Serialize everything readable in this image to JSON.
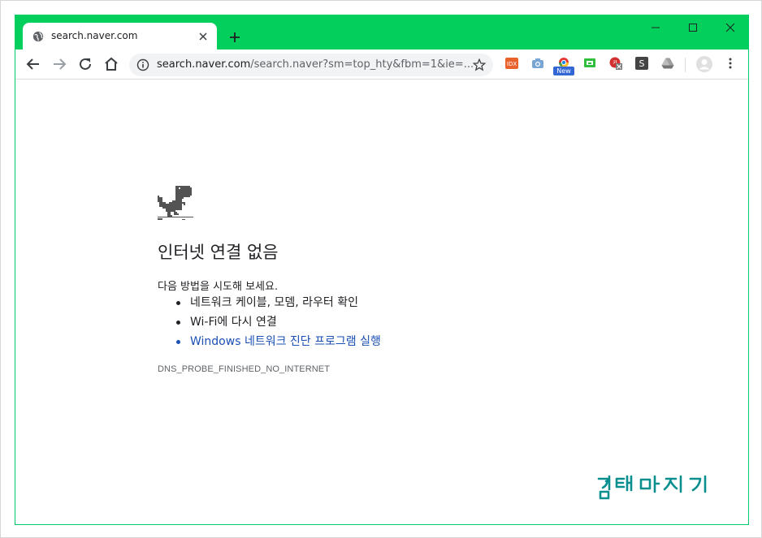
{
  "tab": {
    "title": "search.naver.com",
    "new_tab": "+"
  },
  "omnibox": {
    "host": "search.naver.com",
    "path": "/search.naver?sm=top_hty&fbm=1&ie=..."
  },
  "extensions": [
    {
      "icon": "idx-icon",
      "color": "#e8632b"
    },
    {
      "icon": "camera-icon",
      "color": "#7aa6d6"
    },
    {
      "icon": "chrome-new-icon",
      "color": "#3367d6",
      "badge": "New"
    },
    {
      "icon": "screen-icon",
      "color": "#2fbf3c"
    },
    {
      "icon": "red-blocked-icon",
      "color": "#d32f2f"
    },
    {
      "icon": "s-icon",
      "color": "#444444",
      "label": "S"
    },
    {
      "icon": "drive-icon",
      "color": "#9e9e9e"
    }
  ],
  "error": {
    "title": "인터넷 연결 없음",
    "suggestion": "다음 방법을 시도해 보세요.",
    "tips": [
      "네트워크 케이블, 모뎀, 라우터 확인",
      "Wi-Fi에 다시 연결",
      "Windows 네트워크 진단 프로그램 실행"
    ],
    "code": "DNS_PROBE_FINISHED_NO_INTERNET"
  },
  "watermark": "컴퓨터마지기",
  "colors": {
    "frame": "#03cf5d",
    "link": "#1a4fb4",
    "watermark": "#0a8f8f"
  }
}
